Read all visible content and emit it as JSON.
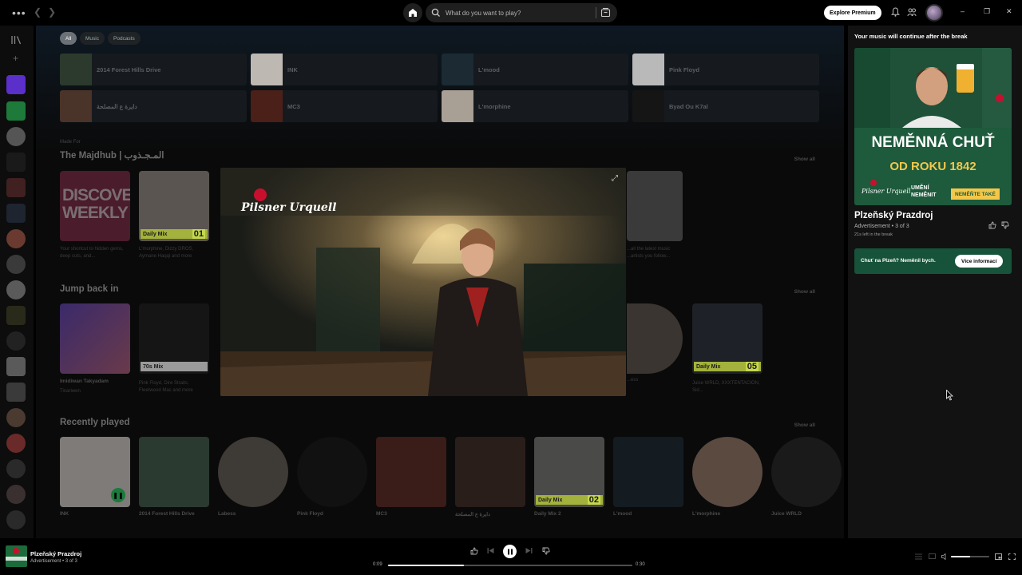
{
  "topbar": {
    "search_placeholder": "What do you want to play?",
    "premium_label": "Explore Premium"
  },
  "main": {
    "filters": [
      "All",
      "Music",
      "Podcasts"
    ],
    "quick_items": [
      {
        "label": "2014 Forest Hills Drive",
        "color": "#2c3a2e"
      },
      {
        "label": "INK",
        "color": "#d8d4cf"
      },
      {
        "label": "L'mood",
        "color": "#1b2a33"
      },
      {
        "label": "Pink Floyd",
        "color": "#e9e9e9"
      },
      {
        "label": "دايرة ع المصلحة",
        "color": "#5b3f33"
      },
      {
        "label": "MC3",
        "color": "#5a2a20"
      },
      {
        "label": "L'morphine",
        "color": "#d8cfc4"
      },
      {
        "label": "Byad Ou K7al",
        "color": "#1a1a1a"
      }
    ],
    "made_for": {
      "small": "Made For",
      "title": "The Majdhub | المـجـذوب",
      "show_all": "Show all",
      "cards": [
        {
          "title": "Your shortcut to hidden gems, deep cuts, and...",
          "sub": ""
        },
        {
          "title": "L'morphine, Dizzy DROS, Aymane Haqqi and more",
          "sub": "",
          "badge": "Daily Mix",
          "num": "01"
        },
        {
          "title": "Release Radar",
          "sub": "...all the latest music ...artists you follow..."
        }
      ]
    },
    "jump_back": {
      "title": "Jump back in",
      "show_all": "Show all",
      "cards": [
        {
          "title": "Imidiwan Takyadam",
          "sub": "Tinariwen"
        },
        {
          "title": "",
          "sub": "Pink Floyd, Dire Straits, Fleetwood Mac and more",
          "badge": "70s Mix"
        },
        {
          "title": "",
          "sub": "...ess"
        },
        {
          "title": "",
          "sub": "Juice WRLD, XXXTENTACION, Sid...",
          "badge": "Daily Mix",
          "num": "05"
        }
      ]
    },
    "recent": {
      "title": "Recently played",
      "show_all": "Show all",
      "items": [
        {
          "title": "INK"
        },
        {
          "title": "2014 Forest Hills Drive"
        },
        {
          "title": "Labess"
        },
        {
          "title": "Pink Floyd"
        },
        {
          "title": "MC3"
        },
        {
          "title": "دايرة ع المصلحة"
        },
        {
          "title": "Daily Mix 2",
          "badge": "Daily Mix",
          "num": "02"
        },
        {
          "title": "L'mood"
        },
        {
          "title": "L'morphine"
        },
        {
          "title": "Juice WRLD"
        }
      ]
    }
  },
  "video": {
    "logo_text": "Pilsner Urquell"
  },
  "right_panel": {
    "heading": "Your music will continue after the break",
    "ad_headline_1": "NEMĚNNÁ CHUŤ",
    "ad_headline_2": "OD ROKU 1842",
    "ad_tag_1": "UMĚNÍ",
    "ad_tag_2": "NEMĚNIT",
    "ad_cta": "NEMĚŇTE TAKÉ",
    "ad_brand": "Pilsner Urquell",
    "advertiser": "Plzeňský Prazdroj",
    "ad_info": "Advertisement • 3 of 3",
    "time_left": "21s left in the break",
    "banner_text": "Chuť na Plzeň? Neměnil bych.",
    "banner_button": "Více informací"
  },
  "player": {
    "title": "Plzeňský Prazdroj",
    "subtitle": "Advertisement • 3 of 3",
    "time_current": "0:09",
    "time_total": "0:30",
    "progress": 0.31,
    "volume": 0.5
  },
  "colors": {
    "accent_green": "#1db954",
    "ad_green": "#1e5a3c",
    "mix_badge": "#a3b23c"
  }
}
